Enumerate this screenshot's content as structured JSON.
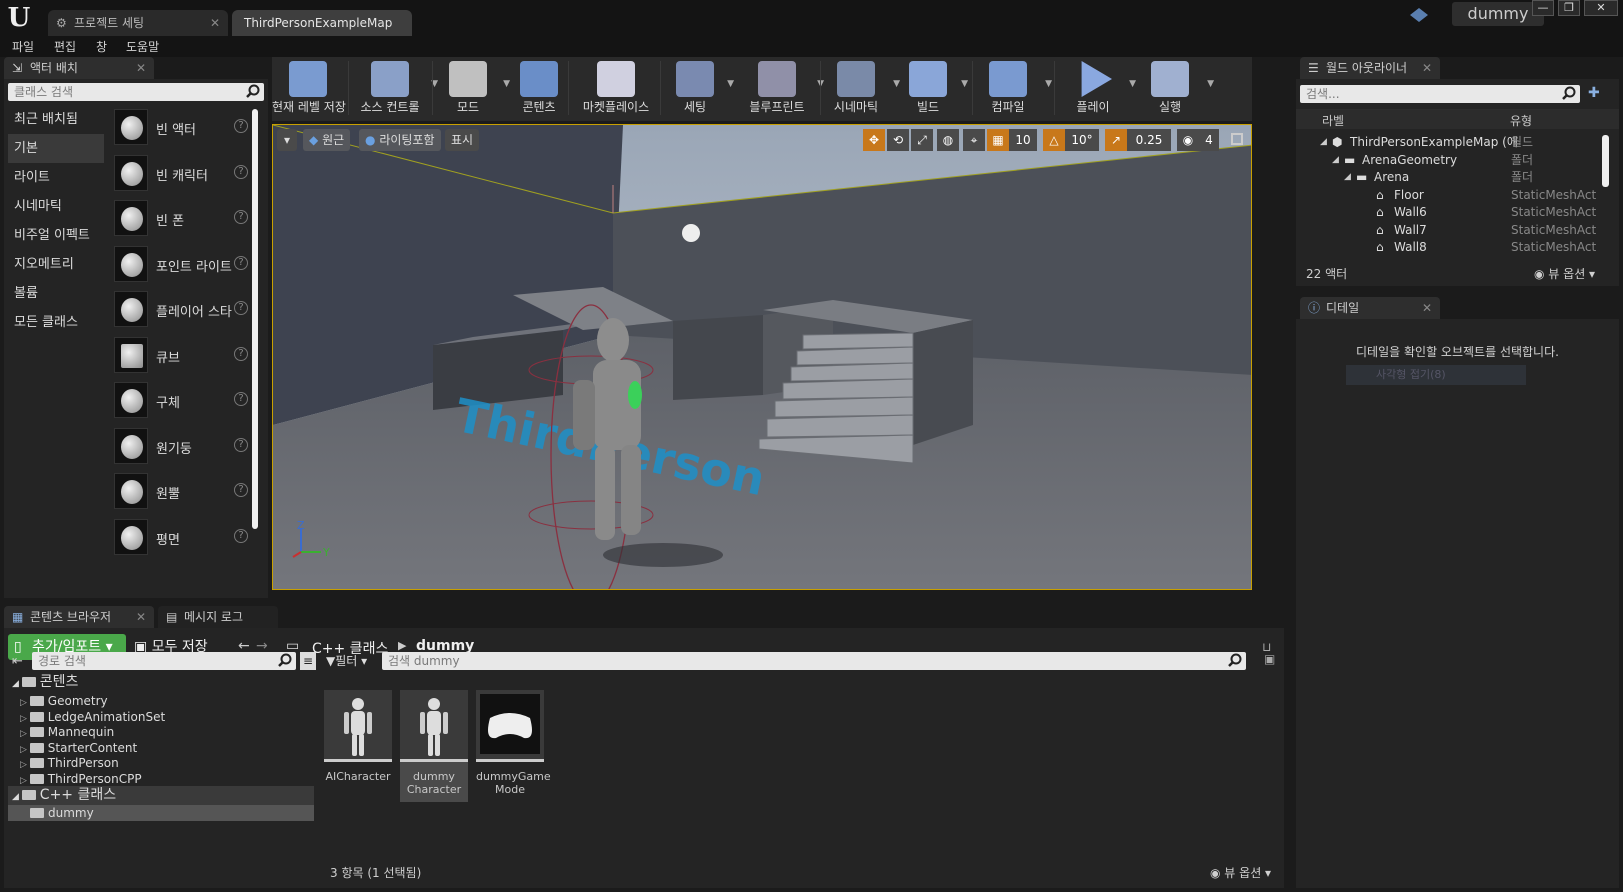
{
  "titlebar": {
    "logo": "U",
    "tabs": [
      {
        "label": "프로젝트 세팅"
      },
      {
        "label": "ThirdPersonExampleMap"
      }
    ],
    "project_name": "dummy",
    "window_buttons": [
      "—",
      "❐",
      "✕"
    ]
  },
  "menu": [
    "파일",
    "편집",
    "창",
    "도움말"
  ],
  "place_panel": {
    "tab": "액터 배치",
    "search_placeholder": "클래스 검색",
    "categories": [
      "최근 배치됨",
      "기본",
      "라이트",
      "시네마틱",
      "비주얼 이펙트",
      "지오메트리",
      "볼륨",
      "모든 클래스"
    ],
    "selected_category": "기본",
    "items": [
      "빈 액터",
      "빈 캐릭터",
      "빈 폰",
      "포인트 라이트",
      "플레이어 스타",
      "큐브",
      "구체",
      "원기둥",
      "원뿔",
      "평면"
    ]
  },
  "toolbar": {
    "buttons": [
      {
        "label": "현재 레벨 저장",
        "icon": "save-icon"
      },
      {
        "label": "소스 컨트롤",
        "icon": "source-control-icon"
      },
      {
        "label": "모드",
        "icon": "modes-icon"
      },
      {
        "label": "콘텐츠",
        "icon": "content-icon"
      },
      {
        "label": "마켓플레이스",
        "icon": "marketplace-icon"
      },
      {
        "label": "세팅",
        "icon": "settings-icon"
      },
      {
        "label": "블루프린트",
        "icon": "blueprint-icon"
      },
      {
        "label": "시네마틱",
        "icon": "cinematics-icon"
      },
      {
        "label": "빌드",
        "icon": "build-icon"
      },
      {
        "label": "컴파일",
        "icon": "compile-icon"
      },
      {
        "label": "플레이",
        "icon": "play-icon"
      },
      {
        "label": "실행",
        "icon": "launch-icon"
      }
    ]
  },
  "viewport": {
    "perspective": "원근",
    "view_mode": "라이팅포함",
    "show": "표시",
    "grid_snap": "10",
    "rotation_snap": "10°",
    "scale_snap": "0.25",
    "camera_speed": "4",
    "axis_z": "Z",
    "axis_y": "Y",
    "floor_text": "ThirdPerson"
  },
  "outliner": {
    "tab": "월드 아웃라이너",
    "search_placeholder": "검색...",
    "col_label": "라벨",
    "col_type": "유형",
    "rows": [
      {
        "label": "ThirdPersonExampleMap (에",
        "type": "월드"
      },
      {
        "label": "ArenaGeometry",
        "type": "폴더"
      },
      {
        "label": "Arena",
        "type": "폴더"
      },
      {
        "label": "Floor",
        "type": "StaticMeshAct"
      },
      {
        "label": "Wall6",
        "type": "StaticMeshAct"
      },
      {
        "label": "Wall7",
        "type": "StaticMeshAct"
      },
      {
        "label": "Wall8",
        "type": "StaticMeshAct"
      }
    ],
    "actor_count": "22 액터",
    "view_options": "뷰 옵션"
  },
  "details": {
    "tab": "디테일",
    "message": "디테일을 확인할 오브젝트를 선택합니다.",
    "ghost": "사각형 접기(8)"
  },
  "bottom_tabs": [
    "콘텐츠 브라우저",
    "메시지 로그"
  ],
  "content_browser": {
    "add_import": "추가/임포트",
    "save_all": "모두 저장",
    "path": [
      "C++ 클래스",
      "dummy"
    ],
    "path_search_placeholder": "경로 검색",
    "filter": "필터",
    "asset_search_placeholder": "검색 dummy",
    "tree_root": "콘텐츠",
    "tree_folders": [
      "Geometry",
      "LedgeAnimationSet",
      "Mannequin",
      "StarterContent",
      "ThirdPerson",
      "ThirdPersonCPP"
    ],
    "cpp_root": "C++ 클래스",
    "cpp_child": "dummy",
    "assets": [
      {
        "line1": "AICharacter",
        "line2": ""
      },
      {
        "line1": "dummy",
        "line2": "Character"
      },
      {
        "line1": "dummyGame",
        "line2": "Mode"
      }
    ],
    "item_count": "3 항목 (1 선택됨)",
    "view_options": "뷰 옵션"
  },
  "colors": {
    "accent_green": "#4aa84a",
    "selection_yellow": "#c8a000",
    "snap_orange": "#c8781a"
  }
}
